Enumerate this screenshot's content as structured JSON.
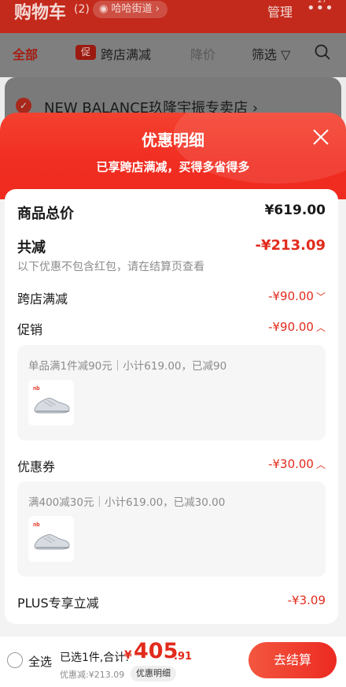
{
  "background": {
    "title": "购物车",
    "count": "(2)",
    "location": "哈哈街道",
    "manage": "管理",
    "more_badge": "27",
    "filters": {
      "all": "全部",
      "cross_tag": "促",
      "cross": "跨店满减",
      "drop": "降价",
      "filter": "筛选"
    },
    "store_name": "NEW BALANCE玖隆宇振专卖店 ›"
  },
  "sheet": {
    "title": "优惠明细",
    "subtitle": "已享跨店满减，买得多省得多",
    "total_label": "商品总价",
    "total_value": "¥619.00",
    "reduce_label": "共减",
    "reduce_value": "-¥213.09",
    "note": "以下优惠不包含红包，请在结算页查看",
    "cross_label": "跨店满减",
    "cross_value": "-¥90.00",
    "promo_label": "促销",
    "promo_value": "-¥90.00",
    "promo_detail": "单品满1件减90元｜小计619.00，已减90",
    "coupon_label": "优惠券",
    "coupon_value": "-¥30.00",
    "coupon_detail": "满400减30元｜小计619.00，已减30.00",
    "plus_label": "PLUS专享立减",
    "plus_value": "-¥3.09"
  },
  "bottom": {
    "select_all": "全选",
    "selected_sum": "已选1件,合计:",
    "yen": "¥",
    "amount_int": "405",
    "amount_dec": ".91",
    "saved": "优惠减:¥213.09",
    "detail_pill": "优惠明细",
    "checkout": "去结算"
  },
  "colors": {
    "accent": "#e22b1c",
    "header_red": "#f12e22"
  },
  "icons": [
    "eye-icon",
    "more-dots-icon",
    "filter-icon",
    "search-icon",
    "check-circle-icon",
    "close-icon",
    "chevron-down-icon",
    "chevron-up-icon",
    "sneaker-thumbnail"
  ]
}
